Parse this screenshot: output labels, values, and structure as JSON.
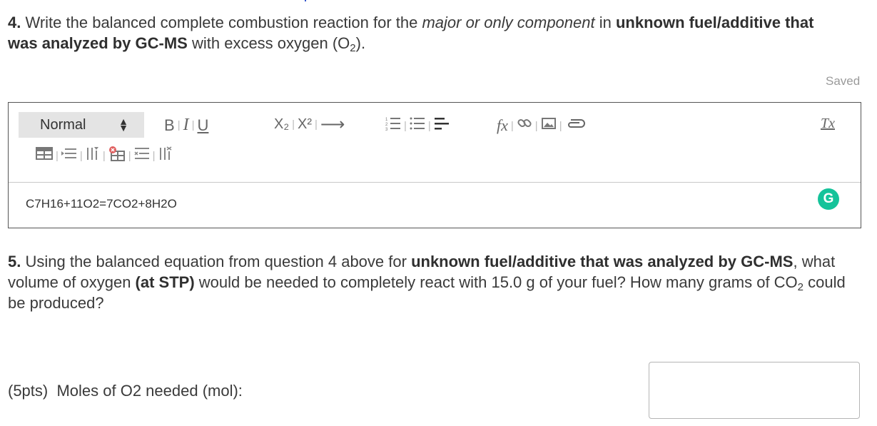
{
  "q4": {
    "num": "4.",
    "t1": " Write the balanced complete combustion reaction for the ",
    "em": "major or only component",
    "t2": " in ",
    "bold": "unknown fuel/additive that was analyzed by GC-MS",
    "t3": " with excess oxygen (O",
    "sub": "2",
    "t4": ")."
  },
  "saved": "Saved",
  "editor": {
    "format_select": "Normal",
    "content": "C7H16+11O2=7CO2+8H2O"
  },
  "toolbar": {
    "bold": "B",
    "italic": "I",
    "underline": "U",
    "subscript": "X₂",
    "superscript": "X²",
    "arrow": "⟶",
    "formula": "fx",
    "clear": "Tx",
    "icons": [
      "bold-icon",
      "italic-icon",
      "underline-icon",
      "subscript-icon",
      "superscript-icon",
      "arrow-icon",
      "ordered-list-icon",
      "unordered-list-icon",
      "align-icon",
      "formula-icon",
      "link-icon",
      "image-icon",
      "attachment-icon",
      "clear-format-icon",
      "insert-table-icon",
      "insert-row-icon",
      "insert-column-icon",
      "delete-table-icon",
      "delete-row-icon",
      "delete-column-icon"
    ]
  },
  "grammarly": "G",
  "q5": {
    "num": "5.",
    "t1": " Using the balanced equation from question 4 above for ",
    "bold1": "unknown fuel/additive that was analyzed by GC-MS",
    "t2": ", what volume of oxygen ",
    "bold2": "(at STP)",
    "t3": " would be needed to completely react with 15.0 g of your fuel? How many grams of CO",
    "sub": "2",
    "t4": " could be produced?"
  },
  "moles": {
    "label": "(5pts)  Moles of O2 needed (mol):",
    "value": ""
  }
}
